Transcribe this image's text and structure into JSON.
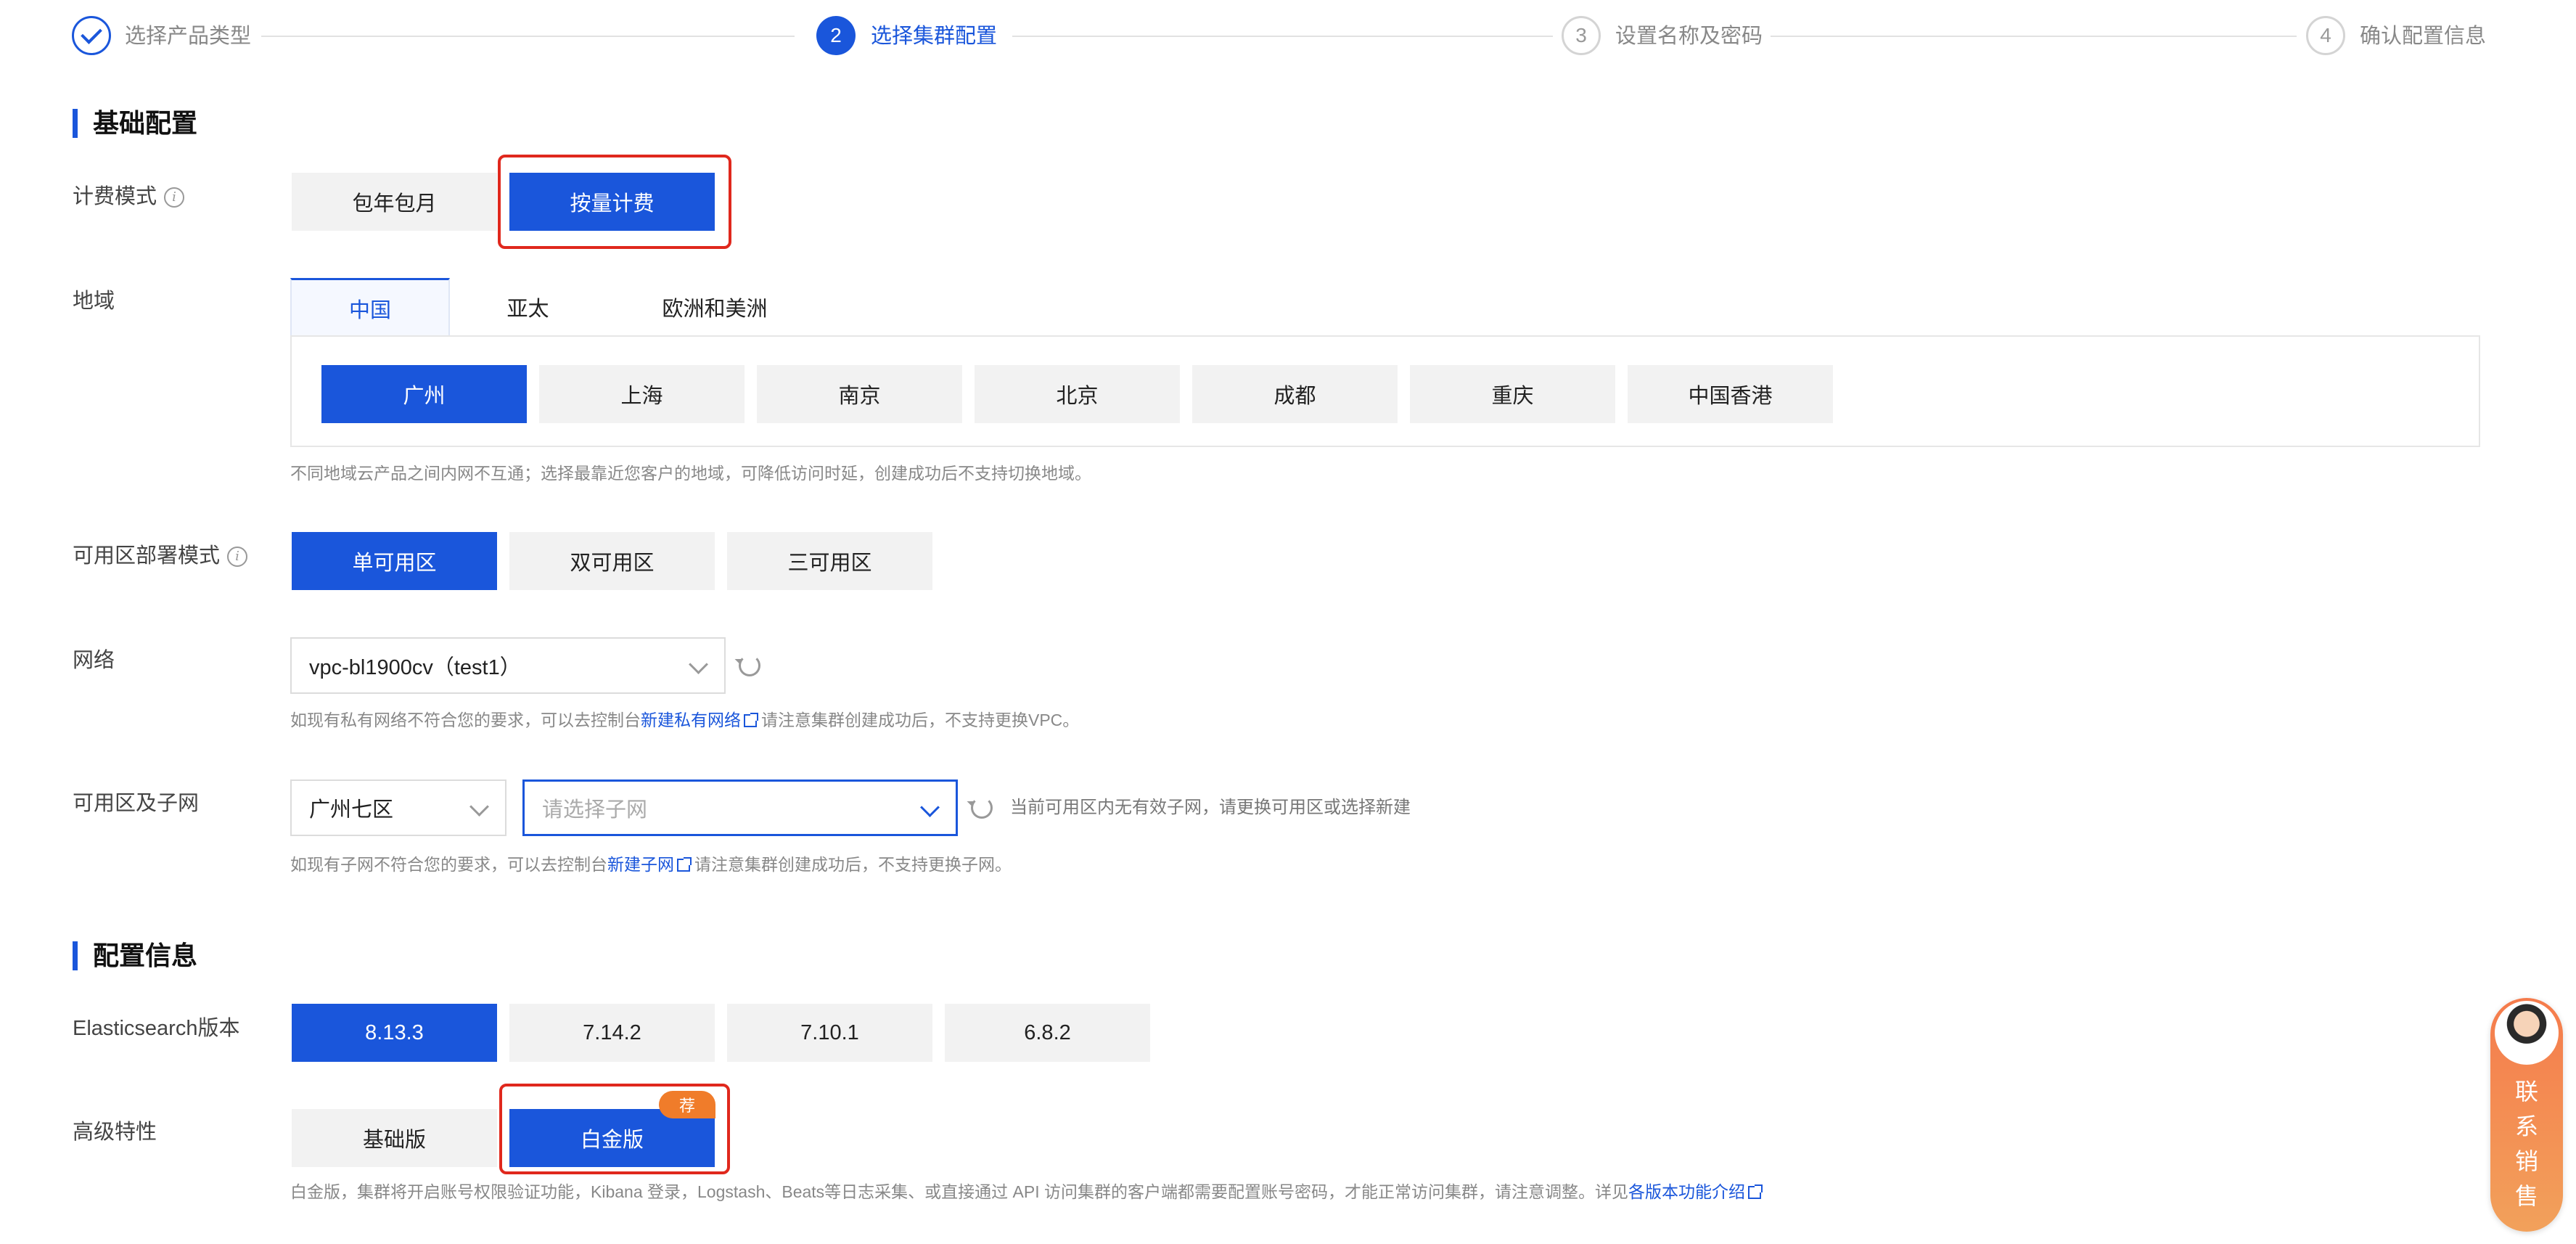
{
  "steps": [
    {
      "number": "",
      "label": "选择产品类型",
      "state": "done"
    },
    {
      "number": "2",
      "label": "选择集群配置",
      "state": "active"
    },
    {
      "number": "3",
      "label": "设置名称及密码",
      "state": "todo"
    },
    {
      "number": "4",
      "label": "确认配置信息",
      "state": "todo"
    }
  ],
  "basic_section": {
    "title": "基础配置",
    "billing": {
      "label": "计费模式",
      "options": [
        "包年包月",
        "按量计费"
      ],
      "selected": "按量计费"
    },
    "region": {
      "label": "地域",
      "tabs": [
        "中国",
        "亚太",
        "欧洲和美洲"
      ],
      "selected_tab": "中国",
      "cities": [
        "广州",
        "上海",
        "南京",
        "北京",
        "成都",
        "重庆",
        "中国香港"
      ],
      "selected_city": "广州",
      "hint": "不同地域云产品之间内网不互通；选择最靠近您客户的地域，可降低访问时延，创建成功后不支持切换地域。"
    },
    "az_mode": {
      "label": "可用区部署模式",
      "options": [
        "单可用区",
        "双可用区",
        "三可用区"
      ],
      "selected": "单可用区"
    },
    "network": {
      "label": "网络",
      "value": "vpc-bl1900cv（test1）",
      "hint_prefix": "如现有私有网络不符合您的要求，可以去控制台",
      "hint_link": "新建私有网络",
      "hint_suffix": "请注意集群创建成功后，不支持更换VPC。"
    },
    "subnet": {
      "label": "可用区及子网",
      "zone_value": "广州七区",
      "subnet_placeholder": "请选择子网",
      "status": "当前可用区内无有效子网，请更换可用区或选择新建",
      "hint_prefix": "如现有子网不符合您的要求，可以去控制台",
      "hint_link": "新建子网",
      "hint_suffix": "请注意集群创建成功后，不支持更换子网。"
    }
  },
  "config_section": {
    "title": "配置信息",
    "es_version": {
      "label": "Elasticsearch版本",
      "options": [
        "8.13.3",
        "7.14.2",
        "7.10.1",
        "6.8.2"
      ],
      "selected": "8.13.3"
    },
    "advanced": {
      "label": "高级特性",
      "options": [
        "基础版",
        "白金版"
      ],
      "selected": "白金版",
      "badge": "荐",
      "hint_prefix": "白金版，集群将开启账号权限验证功能，Kibana 登录，Logstash、Beats等日志采集、或直接通过 API 访问集群的客户端都需要配置账号密码，才能正常访问集群，请注意调整。详见",
      "hint_link": "各版本功能介绍"
    }
  },
  "contact_sales": [
    "联",
    "系",
    "销",
    "售"
  ],
  "colors": {
    "primary": "#1a56db",
    "highlight": "#e0281d",
    "badge": "#f07c2a"
  }
}
